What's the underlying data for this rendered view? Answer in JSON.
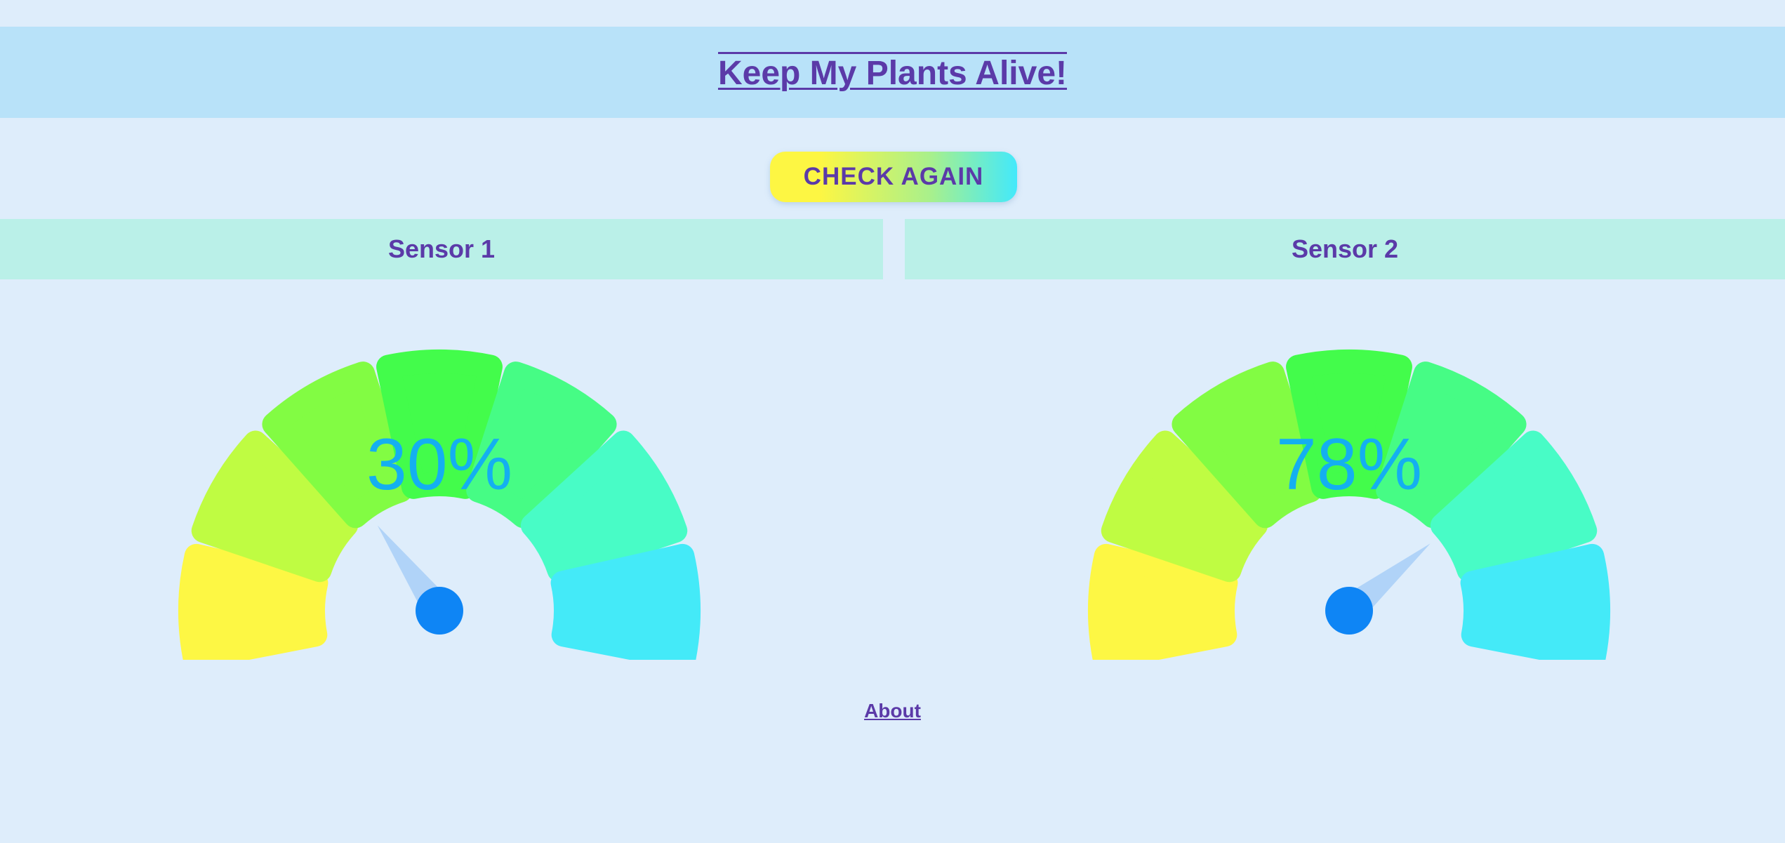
{
  "header": {
    "title": "Keep My Plants Alive!"
  },
  "check_button": {
    "label": "CHECK AGAIN"
  },
  "sensors": [
    {
      "label": "Sensor 1",
      "moisture_percent": 30,
      "reading_text": "30%"
    },
    {
      "label": "Sensor 2",
      "moisture_percent": 78,
      "reading_text": "78%"
    }
  ],
  "gauge_segment_colors": [
    "#fdf744",
    "#bffc42",
    "#82fc43",
    "#43fc4b",
    "#46fc85",
    "#48fcc6",
    "#44eaf8"
  ],
  "needle_colors": {
    "pointer": "#b0d3f8",
    "hub": "#0e85f5"
  },
  "footer": {
    "about_label": "About"
  }
}
